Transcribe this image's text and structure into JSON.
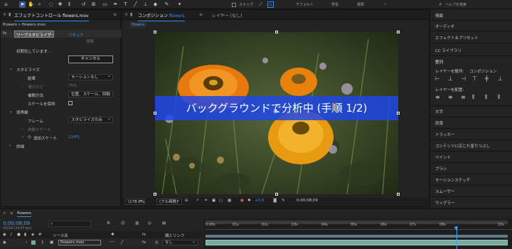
{
  "toolbar": {
    "snap_label": "スナップ",
    "workspaces": [
      "デフォルト",
      "学習",
      "標準"
    ],
    "help_search_placeholder": "ヘルプを検索"
  },
  "effect_controls": {
    "tab_label": "エフェクトコントロール",
    "file_label": "flowers.mov",
    "breadcrumb": "flowers • flowers.mov",
    "effect_name": "ワープスタビライザー",
    "reset_label": "リセット",
    "about_label": "情報",
    "analyzing_label": "初期化しています...",
    "cancel_button": "キャンセル",
    "stabilize_label": "スタビライズ",
    "result_label": "結果",
    "result_value": "モーションなし",
    "smoothness_label": "滑らかさ",
    "smoothness_value": "75%",
    "method_label": "補間方法",
    "method_value": "位置、スケール、回転",
    "keep_scale_label": "スケールを保持",
    "borders_label": "境界線",
    "frame_label": "フレーム",
    "frame_value": "スタビライズのみ",
    "auto_scale_label": "自動スケール",
    "extra_scale_label": "追加スケール",
    "extra_scale_value": "114%",
    "advanced_label": "詳細"
  },
  "composition": {
    "tab_label": "コンポジション",
    "comp_name": "flowers",
    "layer_tab_label": "レイヤー (なし)",
    "comp_chip": "flowers",
    "overlay_text": "バックグラウンドで分析中 (手順 1/2)",
    "zoom_value": "(178.9%)",
    "resolution_value": "(フル画質)",
    "exposure_value": "+0.0",
    "timecode_value": "0;00;08;09"
  },
  "right_panel": {
    "items": [
      "情報",
      "オーディオ",
      "エフェクト＆プリセット",
      "CC ライブラリ",
      "整列"
    ],
    "align_label": "レイヤーを整列:",
    "align_target": "コンポジション",
    "distribute_label": "レイヤーを配置:",
    "items2": [
      "文字",
      "段落",
      "トラッカー",
      "コンテンツに応じた塗りつぶし",
      "ペイント",
      "ブラシ",
      "モーションスケッチ",
      "スムーザー",
      "ウィグラー"
    ]
  },
  "timeline": {
    "tab_label": "flowers",
    "timecode": "0;00;08;09",
    "frame_info": "00249 (29.97 fps)",
    "search_placeholder": "",
    "source_name_header": "ソース名",
    "parent_header": "親とリンク",
    "layer_index": "1",
    "layer_name": "flowers.mov",
    "parent_value": "なし",
    "ticks": [
      "0:00s",
      "01s",
      "02s",
      "03s",
      "04s",
      "05s",
      "06s",
      "07s",
      "08s",
      "10s"
    ],
    "playhead_fraction": 0.83
  },
  "colors": {
    "accent_blue": "#2d8ceb",
    "overlay_band": "#1e46e6",
    "timeline_layer": "#7aa89c"
  }
}
